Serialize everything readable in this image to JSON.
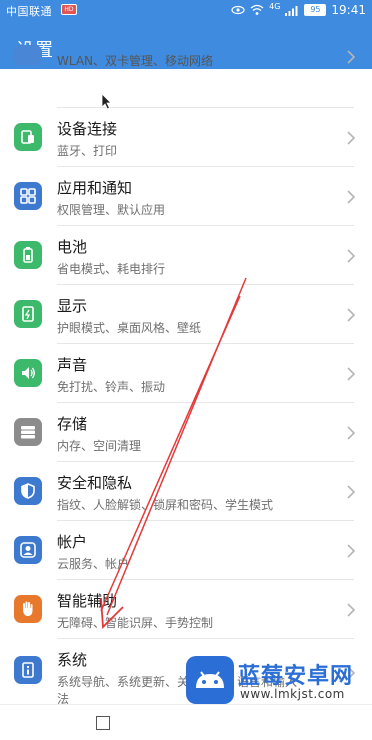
{
  "status_bar": {
    "carrier": "中国联通",
    "carrier_badge": "HD",
    "signal_label": "4G",
    "battery": "95",
    "time": "19:41"
  },
  "header": {
    "title": "设置"
  },
  "settings": [
    {
      "title": "",
      "subtitle": "WLAN、双卡管理、移动网络",
      "icon": "network-icon",
      "color": "#4a86d6"
    },
    {
      "title": "设备连接",
      "subtitle": "蓝牙、打印",
      "icon": "device-connect-icon",
      "color": "#3cb96b"
    },
    {
      "title": "应用和通知",
      "subtitle": "权限管理、默认应用",
      "icon": "apps-icon",
      "color": "#3d79cf"
    },
    {
      "title": "电池",
      "subtitle": "省电模式、耗电排行",
      "icon": "battery-icon",
      "color": "#3cb96b"
    },
    {
      "title": "显示",
      "subtitle": "护眼模式、桌面风格、壁纸",
      "icon": "display-icon",
      "color": "#3cb96b"
    },
    {
      "title": "声音",
      "subtitle": "免打扰、铃声、振动",
      "icon": "sound-icon",
      "color": "#3cb96b"
    },
    {
      "title": "存储",
      "subtitle": "内存、空间清理",
      "icon": "storage-icon",
      "color": "#8c8c8c"
    },
    {
      "title": "安全和隐私",
      "subtitle": "指纹、人脸解锁、锁屏和密码、学生模式",
      "icon": "shield-icon",
      "color": "#3d79cf"
    },
    {
      "title": "帐户",
      "subtitle": "云服务、帐户",
      "icon": "account-icon",
      "color": "#3d79cf"
    },
    {
      "title": "智能辅助",
      "subtitle": "无障碍、智能识屏、手势控制",
      "icon": "hand-icon",
      "color": "#e8782b"
    },
    {
      "title": "系统",
      "subtitle": "系统导航、系统更新、关于手机、语言和输入",
      "subtitle2": "法",
      "icon": "system-info-icon",
      "color": "#3d79cf"
    }
  ],
  "watermark": {
    "name": "蓝莓安卓网",
    "url": "www.lmkjst.com"
  },
  "colors": {
    "header": "#3f8bdf",
    "annotation_arrow": "#e23a3a"
  }
}
